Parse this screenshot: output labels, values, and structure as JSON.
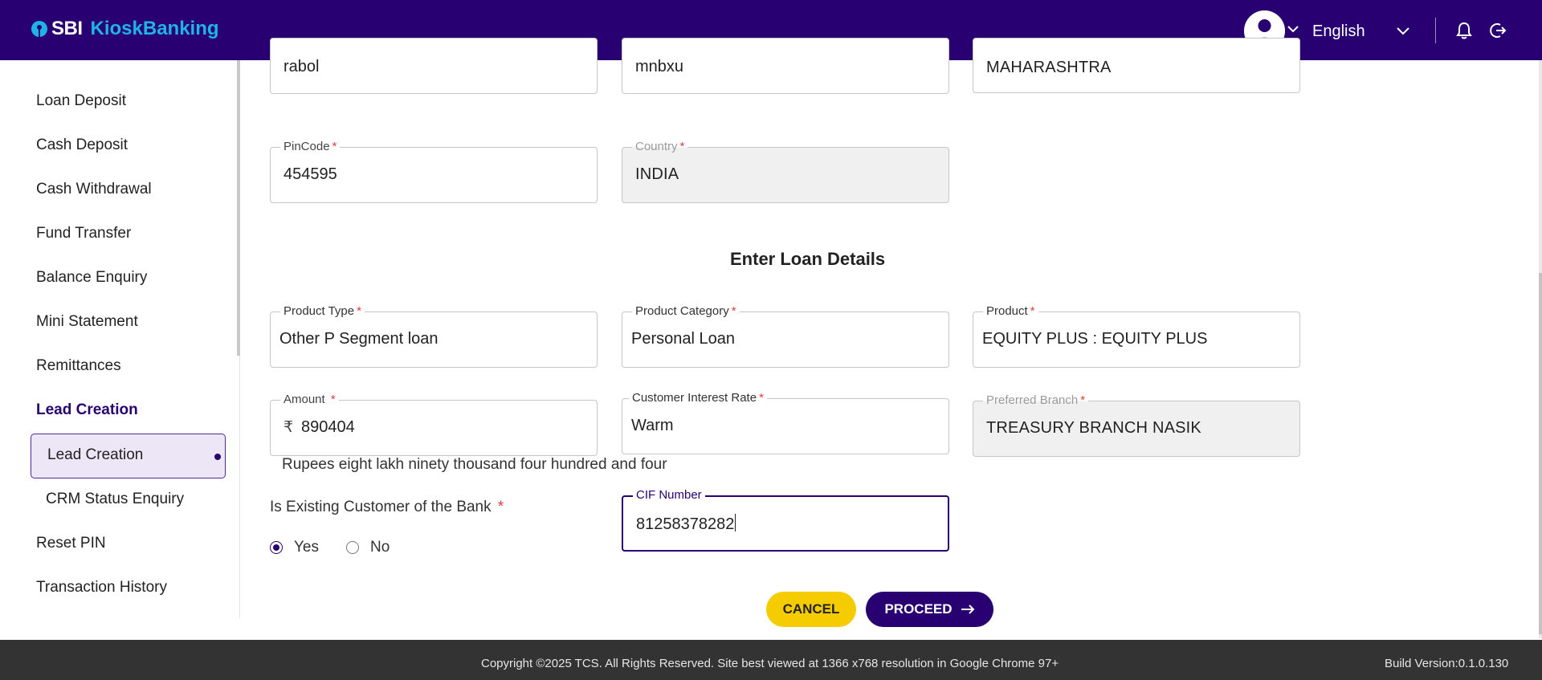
{
  "header": {
    "logo_sbi": "SBI",
    "logo_kiosk": "KioskBanking",
    "language": "English",
    "colors": {
      "header_bg": "#280071",
      "logo_accent": "#1fb4e6"
    }
  },
  "sidebar": {
    "items": [
      {
        "label": "Loan Deposit"
      },
      {
        "label": "Cash Deposit"
      },
      {
        "label": "Cash Withdrawal"
      },
      {
        "label": "Fund Transfer"
      },
      {
        "label": "Balance Enquiry"
      },
      {
        "label": "Mini Statement"
      },
      {
        "label": "Remittances"
      },
      {
        "label": "Lead Creation",
        "active": true
      },
      {
        "label": "Lead Creation",
        "sub": true,
        "selected": true
      },
      {
        "label": "CRM Status Enquiry",
        "sub": true
      },
      {
        "label": "Reset PIN"
      },
      {
        "label": "Transaction History"
      }
    ]
  },
  "address": {
    "city": {
      "value": "rabol"
    },
    "district": {
      "value": "mnbxu"
    },
    "state": {
      "value": "MAHARASHTRA"
    },
    "pincode": {
      "label": "PinCode",
      "required": "*",
      "value": "454595"
    },
    "country": {
      "label": "Country",
      "required": "*",
      "value": "INDIA"
    }
  },
  "loan": {
    "section_title": "Enter Loan Details",
    "product_type": {
      "label": "Product Type",
      "required": "*",
      "value": "Other P Segment loan"
    },
    "product_category": {
      "label": "Product Category",
      "required": "*",
      "value": "Personal Loan"
    },
    "product": {
      "label": "Product",
      "required": "*",
      "value": "EQUITY PLUS : EQUITY PLUS"
    },
    "amount": {
      "label": "Amount",
      "required": "*",
      "currency": "₹",
      "value": "890404",
      "in_words": "Rupees eight lakh ninety thousand four hundred and four"
    },
    "interest_rate": {
      "label": "Customer Interest Rate",
      "required": "*",
      "value": "Warm"
    },
    "preferred_branch": {
      "label": "Preferred Branch",
      "required": "*",
      "value": "TREASURY BRANCH NASIK"
    },
    "existing_customer": {
      "label": "Is Existing Customer of the Bank",
      "required": "*",
      "options": [
        "Yes",
        "No"
      ],
      "selected": "Yes"
    },
    "cif": {
      "label": "CIF Number",
      "value": "81258378282"
    }
  },
  "actions": {
    "cancel": "CANCEL",
    "proceed": "PROCEED"
  },
  "footer": {
    "copyright": "Copyright ©2025 TCS. All Rights Reserved. Site best viewed at 1366 x768 resolution in Google Chrome 97+",
    "build": "Build Version:0.1.0.130"
  }
}
